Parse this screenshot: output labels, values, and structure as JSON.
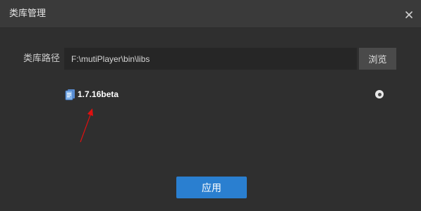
{
  "window": {
    "title": "类库管理",
    "close_icon": "close-icon"
  },
  "form": {
    "path_label": "类库路径",
    "path_value": "F:\\mutiPlayer\\bin\\libs",
    "browse_label": "浏览"
  },
  "libraries": [
    {
      "name": "1.7.16beta",
      "icon": "file-icon",
      "selected": true
    }
  ],
  "annotation": {
    "arrow_color": "#e01010"
  },
  "footer": {
    "apply_label": "应用"
  },
  "colors": {
    "accent": "#2a7fd0",
    "background": "#2f2f2f",
    "titlebar": "#3a3a3a",
    "input_bg": "#262626"
  }
}
